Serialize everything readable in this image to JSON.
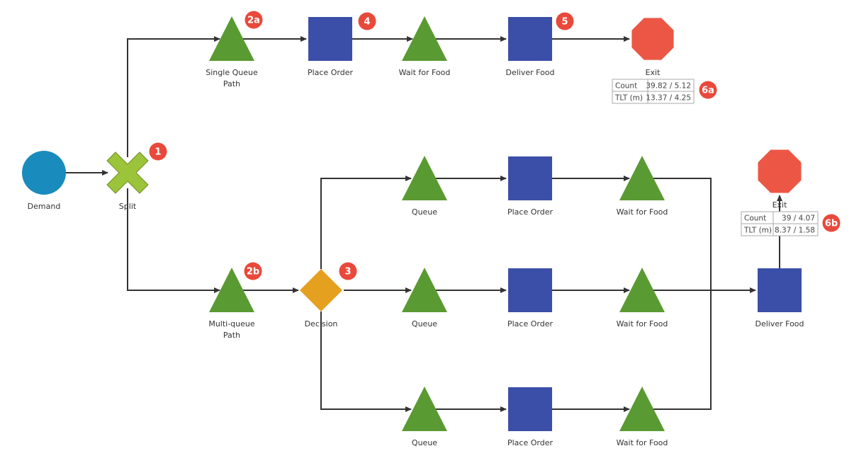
{
  "colors": {
    "triangle": "#5a9a32",
    "square": "#3b4fa8",
    "exit": "#ec5745",
    "demand": "#1a8bbd",
    "split": "#9bc43a",
    "decision": "#e6a020",
    "badge": "#e9493b"
  },
  "nodes": {
    "demand": {
      "label": "Demand"
    },
    "split": {
      "label": "Split"
    },
    "single_queue": {
      "label": [
        "Single Queue",
        "Path"
      ]
    },
    "top_place_order": {
      "label": "Place Order"
    },
    "top_wait": {
      "label": "Wait for Food"
    },
    "top_deliver": {
      "label": "Deliver Food"
    },
    "top_exit": {
      "label": "Exit"
    },
    "multi_queue": {
      "label": [
        "Multi-queue",
        "Path"
      ]
    },
    "decision": {
      "label": "Decision"
    },
    "rows": [
      {
        "queue": "Queue",
        "place": "Place Order",
        "wait": "Wait for Food"
      },
      {
        "queue": "Queue",
        "place": "Place Order",
        "wait": "Wait for Food"
      },
      {
        "queue": "Queue",
        "place": "Place Order",
        "wait": "Wait for Food"
      }
    ],
    "bottom_deliver": {
      "label": "Deliver Food"
    },
    "bottom_exit": {
      "label": "Exit"
    }
  },
  "badges": {
    "b1": "1",
    "b2a": "2a",
    "b2b": "2b",
    "b3": "3",
    "b4": "4",
    "b5": "5",
    "b6a": "6a",
    "b6b": "6b"
  },
  "stats_6a": {
    "rows": [
      [
        "Count",
        "39.82 / 5.12"
      ],
      [
        "TLT (m)",
        "13.37 / 4.25"
      ]
    ]
  },
  "stats_6b": {
    "rows": [
      [
        "Count",
        "39 / 4.07"
      ],
      [
        "TLT (m)",
        "8.37 / 1.58"
      ]
    ]
  }
}
